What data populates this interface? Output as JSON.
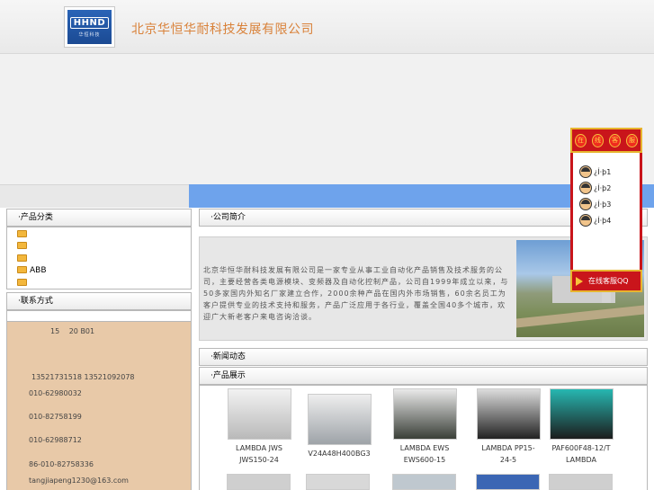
{
  "header": {
    "site_title": "北京华恒华耐科技发展有限公司",
    "logo_text": "HHND",
    "logo_sub": "华恒科技"
  },
  "left": {
    "categories_title": "产品分类",
    "categories": [
      "",
      "",
      "",
      "ABB",
      ""
    ],
    "contact_title": "联系方式",
    "contact_lines": [
      "15　 20 B01",
      "13521731518 13521092078",
      "010-62980032",
      "010-82758199",
      "010-62988712",
      "86-010-82758336",
      "tangjiapeng1230@163.com"
    ]
  },
  "main": {
    "intro_title": "公司简介",
    "intro_text": "北京华恒华耐科技发展有限公司是一家专业从事工业自动化产品销售及技术服务的公司，主要经营各类电源模块、变频器及自动化控制产品，公司自1999年成立以来，与50多家国内外知名厂家建立合作，2000余种产品在国内外市场销售，60余名员工为客户提供专业的技术支持和服务，产品广泛应用于各行业，覆盖全国40多个城市，欢迎广大新老客户来电咨询洽谈。",
    "news_title": "新闻动态",
    "products_title": "产品展示",
    "products": [
      {
        "name": "LAMBDA JWS JWS150-24"
      },
      {
        "name": "V24A48H400BG3"
      },
      {
        "name": "LAMBDA EWS EWS600-15"
      },
      {
        "name": "LAMBDA PP15-24-5"
      },
      {
        "name": "PAF600F48-12/T LAMBDA"
      }
    ]
  },
  "float_service": {
    "lanterns": [
      "在",
      "线",
      "客",
      "服"
    ],
    "qq_items": [
      "¿Í·þ1",
      "¿Í·þ2",
      "¿Í·þ3",
      "¿Í·þ4"
    ],
    "button_label": "在线客服QQ"
  },
  "colors": {
    "title": "#d9823a",
    "nav": "#6ea3ec",
    "contact_bg": "#e8c9a8",
    "service_red": "#c9151b"
  }
}
